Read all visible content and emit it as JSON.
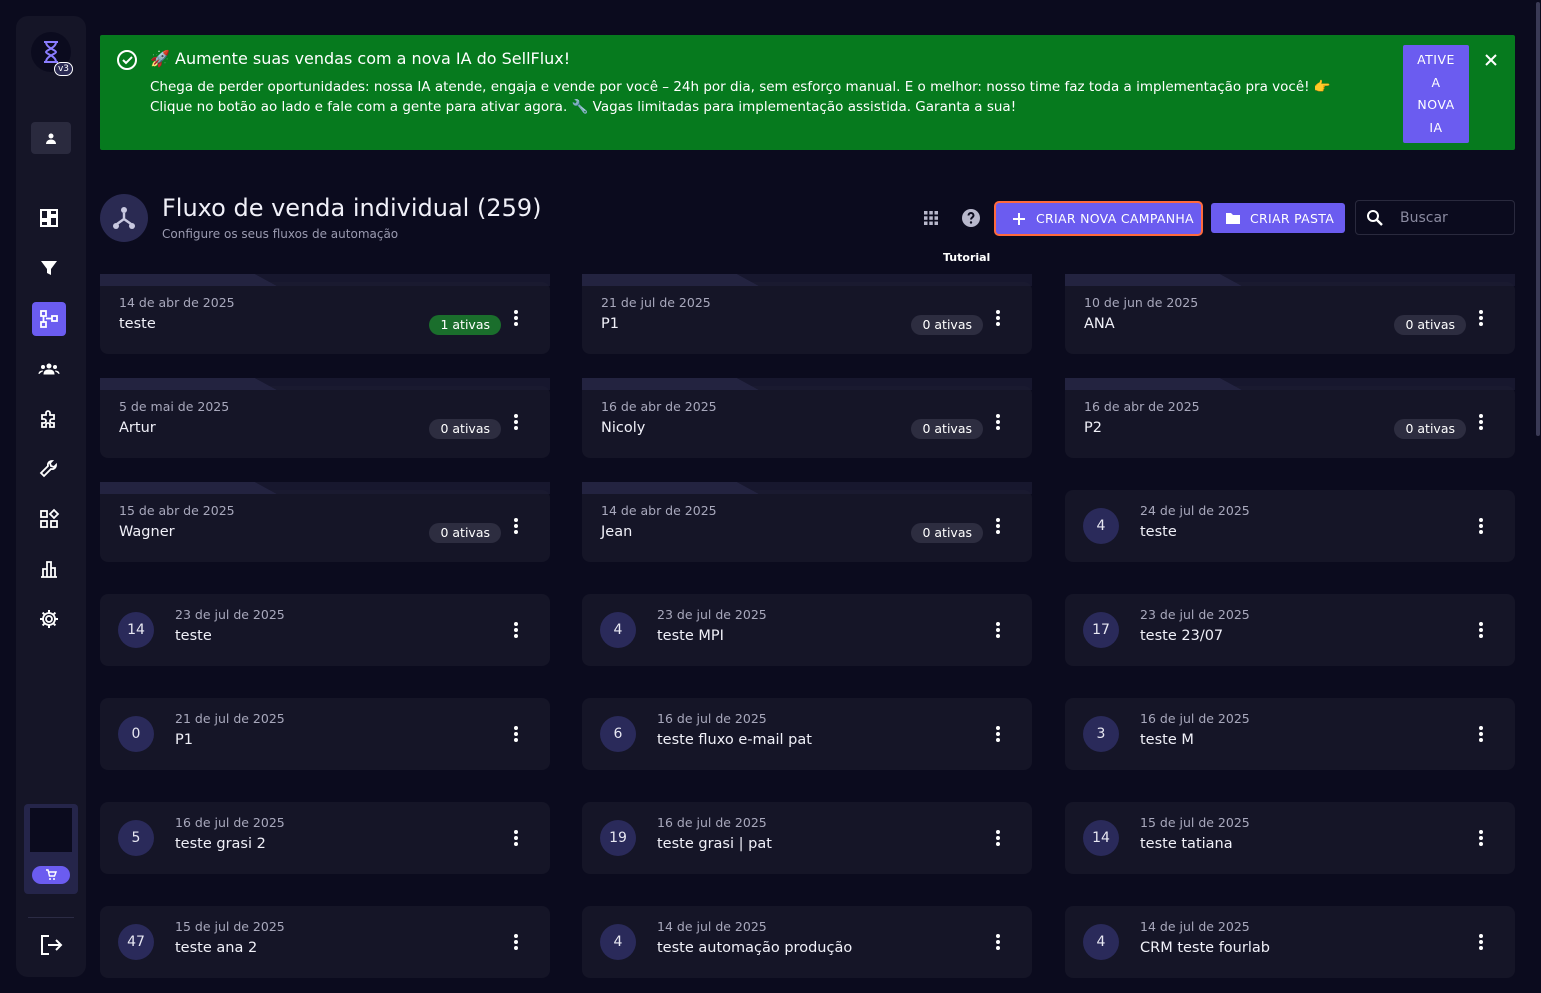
{
  "sidebar": {
    "version_badge": "v3",
    "nav": [
      {
        "name": "dashboard-icon",
        "active": false
      },
      {
        "name": "funnel-icon",
        "active": false
      },
      {
        "name": "flow-icon",
        "active": true
      },
      {
        "name": "contacts-icon",
        "active": false
      },
      {
        "name": "integrations-icon",
        "active": false
      },
      {
        "name": "tools-icon",
        "active": false
      },
      {
        "name": "apps-icon",
        "active": false
      },
      {
        "name": "reports-icon",
        "active": false
      },
      {
        "name": "settings-icon",
        "active": false
      }
    ]
  },
  "banner": {
    "title": "🚀 Aumente suas vendas com a nova IA do SellFlux!",
    "text": "Chega de perder oportunidades: nossa IA atende, engaja e vende por você – 24h por dia, sem esforço manual. E o melhor: nosso time faz toda a implementação pra você! 👉 Clique no botão ao lado e fale com a gente para ativar agora. 🔧 Vagas limitadas para implementação assistida. Garanta a sua!",
    "button_lines": [
      "ATIVE",
      "A",
      "NOVA",
      "IA"
    ],
    "color": "#067a1e"
  },
  "header": {
    "title": "Fluxo de venda individual (259)",
    "subtitle": "Configure os seus fluxos de automação",
    "tooltip": "Tutorial",
    "create_campaign": "CRIAR NOVA CAMPANHA",
    "create_folder": "CRIAR PASTA",
    "search_placeholder": "Buscar"
  },
  "accent": "#6b5cf0",
  "folders": [
    {
      "date": "14 de abr de 2025",
      "name": "teste",
      "active": "1 ativas",
      "green": true
    },
    {
      "date": "21 de jul de 2025",
      "name": "P1",
      "active": "0 ativas",
      "green": false
    },
    {
      "date": "10 de jun de 2025",
      "name": "ANA",
      "active": "0 ativas",
      "green": false
    },
    {
      "date": "5 de mai de 2025",
      "name": "Artur",
      "active": "0 ativas",
      "green": false
    },
    {
      "date": "16 de abr de 2025",
      "name": "Nicoly",
      "active": "0 ativas",
      "green": false
    },
    {
      "date": "16 de abr de 2025",
      "name": "P2",
      "active": "0 ativas",
      "green": false
    },
    {
      "date": "15 de abr de 2025",
      "name": "Wagner",
      "active": "0 ativas",
      "green": false
    },
    {
      "date": "14 de abr de 2025",
      "name": "Jean",
      "active": "0 ativas",
      "green": false
    }
  ],
  "flows": [
    {
      "count": "4",
      "date": "24 de jul de 2025",
      "name": "teste"
    },
    {
      "count": "14",
      "date": "23 de jul de 2025",
      "name": "teste"
    },
    {
      "count": "4",
      "date": "23 de jul de 2025",
      "name": "teste MPI"
    },
    {
      "count": "17",
      "date": "23 de jul de 2025",
      "name": "teste 23/07"
    },
    {
      "count": "0",
      "date": "21 de jul de 2025",
      "name": "P1"
    },
    {
      "count": "6",
      "date": "16 de jul de 2025",
      "name": "teste fluxo e-mail pat"
    },
    {
      "count": "3",
      "date": "16 de jul de 2025",
      "name": "teste M"
    },
    {
      "count": "5",
      "date": "16 de jul de 2025",
      "name": "teste grasi 2"
    },
    {
      "count": "19",
      "date": "16 de jul de 2025",
      "name": "teste grasi | pat"
    },
    {
      "count": "14",
      "date": "15 de jul de 2025",
      "name": "teste tatiana"
    },
    {
      "count": "47",
      "date": "15 de jul de 2025",
      "name": "teste ana 2"
    },
    {
      "count": "4",
      "date": "14 de jul de 2025",
      "name": "teste automação produção"
    },
    {
      "count": "4",
      "date": "14 de jul de 2025",
      "name": "CRM teste fourlab"
    }
  ]
}
